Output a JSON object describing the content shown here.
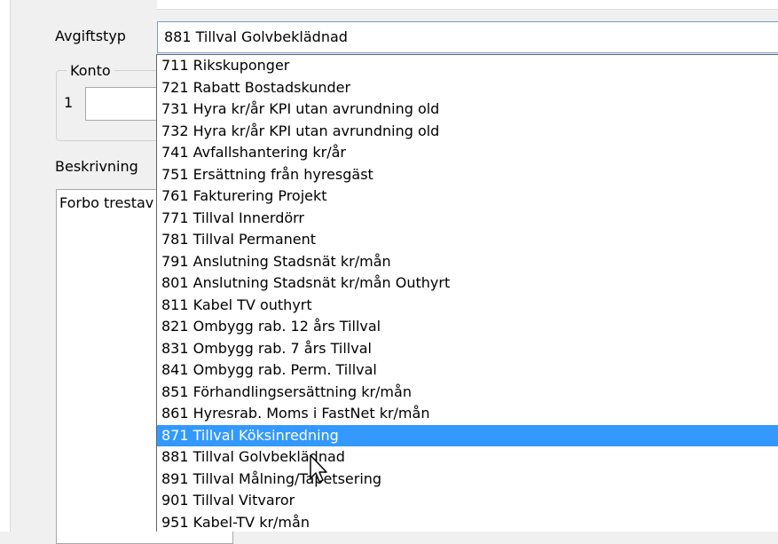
{
  "form": {
    "avgiftstyp_label": "Avgiftstyp",
    "avgiftstyp_value": "881 Tillval Golvbeklädnad",
    "konto_group_title": "Konto",
    "konto_row_number": "1",
    "beskrivning_label": "Beskrivning",
    "beskrivning_text": "Forbo trestav"
  },
  "dropdown": {
    "selected_index": 17,
    "options": [
      "711 Rikskuponger",
      "721 Rabatt Bostadskunder",
      "731 Hyra kr/år KPI utan avrundning old",
      "732 Hyra kr/år KPI utan avrundning old",
      "741 Avfallshantering kr/år",
      "751 Ersättning från hyresgäst",
      "761 Fakturering Projekt",
      "771 Tillval Innerdörr",
      "781 Tillval Permanent",
      "791 Anslutning Stadsnät kr/mån",
      "801 Anslutning Stadsnät kr/mån Outhyrt",
      "811 Kabel TV outhyrt",
      "821 Ombygg rab. 12 års Tillval",
      "831 Ombygg rab. 7 års Tillval",
      "841 Ombygg rab. Perm. Tillval",
      "851 Förhandlingsersättning kr/mån",
      "861 Hyresrab. Moms i FastNet kr/mån",
      "871 Tillval Köksinredning",
      "881 Tillval Golvbeklädnad",
      "891 Tillval Målning/Tapetsering",
      "901 Tillval Vitvaror",
      "951 Kabel-TV kr/mån"
    ]
  },
  "colors": {
    "selection": "#3399ff",
    "combo_border": "#7a9cc7"
  },
  "icons": {
    "cursor": "mouse-pointer-icon"
  }
}
